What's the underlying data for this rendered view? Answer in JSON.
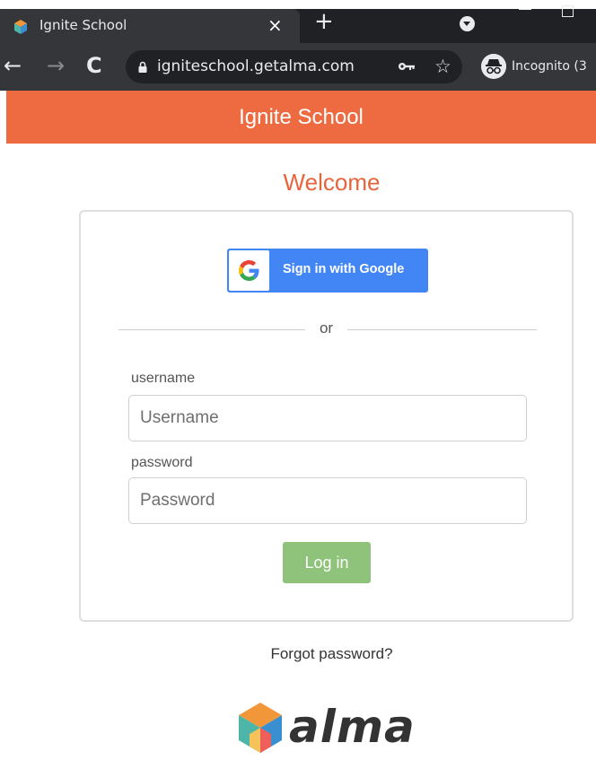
{
  "browser": {
    "tab": {
      "title": "Ignite School",
      "close_glyph": "×"
    },
    "newtab_glyph": "+",
    "toolbar": {
      "back_glyph": "←",
      "forward_glyph": "→",
      "reload_glyph": "C",
      "url": "igniteschool.getalma.com",
      "bookmark_glyph": "☆",
      "incognito_label": "Incognito (3"
    }
  },
  "page": {
    "header_title": "Ignite School",
    "welcome": "Welcome",
    "google_button_label": "Sign in with Google",
    "divider_text": "or",
    "username": {
      "label": "username",
      "placeholder": "Username",
      "value": ""
    },
    "password": {
      "label": "password",
      "placeholder": "Password",
      "value": ""
    },
    "login_button": "Log in",
    "forgot_link": "Forgot password?",
    "logo_text": "alma"
  },
  "colors": {
    "brand_orange": "#ee6a40",
    "login_green": "#8fc27a",
    "google_blue": "#4285f4"
  }
}
